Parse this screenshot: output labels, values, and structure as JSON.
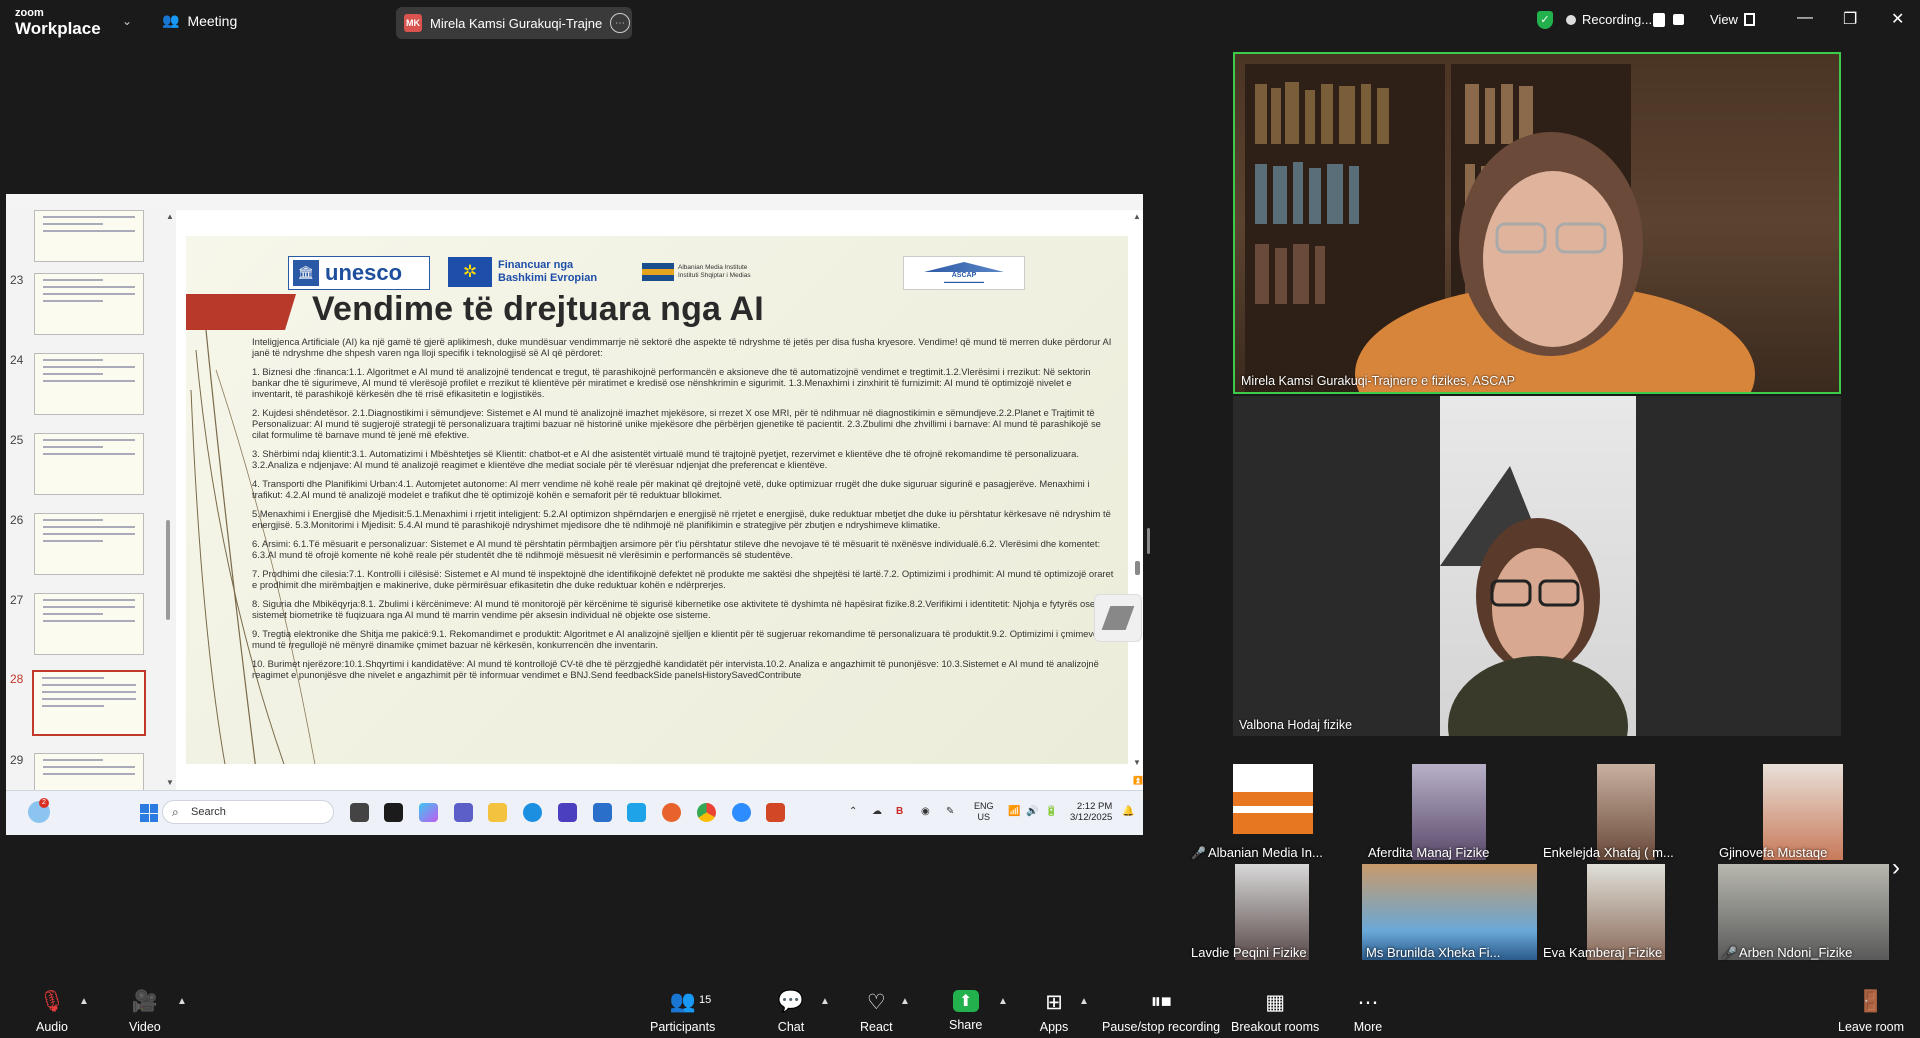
{
  "app": {
    "logo_top": "zoom",
    "logo_bottom": "Workplace",
    "meeting_label": "Meeting",
    "speaker_initials": "MK",
    "speaker_pill": "Mirela Kamsi Gurakuqi-Trajnere e",
    "recording_label": "Recording...",
    "view_label": "View"
  },
  "slides_panel": {
    "items": [
      {
        "num": "23"
      },
      {
        "num": "24"
      },
      {
        "num": "25"
      },
      {
        "num": "26"
      },
      {
        "num": "27"
      },
      {
        "num": "28",
        "active": true
      },
      {
        "num": "29"
      }
    ]
  },
  "slide": {
    "logo_unesco": "unesco",
    "logo_eu_line1": "Financuar nga",
    "logo_eu_line2": "Bashkimi Evropian",
    "logo_ami_line1": "Albanian Media Institute",
    "logo_ami_line2": "Instituti Shqiptar i Medias",
    "logo_ascap": "ASCAP",
    "title": "Vendime të drejtuara nga AI",
    "intro": "Inteligjenca Artificiale (AI) ka një gamë të gjerë aplikimesh, duke mundësuar vendimmarrje në sektorë dhe aspekte të ndryshme të jetës per disa fusha kryesore. Vendime! që mund të merren duke përdorur AI janë të ndryshme dhe shpesh varen nga lloji specifik i teknologjisë së AI që përdoret:",
    "p1": "1. Biznesi dhe :financa:1.1. Algoritmet e AI mund të analizojnë tendencat e tregut, të parashikojnë performancën e aksioneve dhe të automatizojnë vendimet e tregtimit.1.2.Vlerësimi i rrezikut: Në sektorin bankar dhe të sigurimeve, AI mund të vlerësojë profilet e rrezikut të klientëve për miratimet e kredisë ose nënshkrimin e sigurimit. 1.3.Menaxhimi i zinxhirit të furnizimit: AI mund të optimizojë nivelet e inventarit, të parashikojë kërkesën dhe të rrisë efikasitetin e logjistikës.",
    "p2": "2. Kujdesi shëndetësor. 2.1.Diagnostikimi i sëmundjeve: Sistemet e AI mund të analizojnë imazhet mjekësore, si rrezet X ose MRI, për të ndihmuar në diagnostikimin e sëmundjeve.2.2.Planet e Trajtimit të Personalizuar: AI mund të sugjerojë strategji të personalizuara trajtimi bazuar në historinë unike mjekësore dhe përbërjen gjenetike të pacientit. 2.3.Zbulimi dhe zhvillimi i barnave: AI mund të parashikojë se cilat formulime të barnave mund të jenë më efektive.",
    "p3": "3. Shërbimi ndaj klientit:3.1. Automatizimi i Mbështetjes së Klientit: chatbot-et e AI dhe asistentët virtualë mund të trajtojnë pyetjet, rezervimet e klientëve dhe të ofrojnë rekomandime të personalizuara. 3.2.Analiza e ndjenjave: AI mund të analizojë reagimet e klientëve dhe mediat sociale për të vlerësuar ndjenjat dhe preferencat e klientëve.",
    "p4": "4. Transporti dhe Planifikimi Urban:4.1. Automjetet autonome: AI merr vendime në kohë reale për makinat që drejtojnë vetë, duke optimizuar rrugët dhe duke siguruar sigurinë e pasagjerëve. Menaxhimi i trafikut: 4.2.AI mund të analizojë modelet e trafikut dhe të optimizojë kohën e semaforit për të reduktuar bllokimet.",
    "p5": "5.Menaxhimi i Energjisë dhe Mjedisit:5.1.Menaxhimi i rrjetit inteligjent: 5.2.AI optimizon shpërndarjen e energjisë në rrjetet e energjisë, duke reduktuar mbetjet dhe duke iu përshtatur kërkesave në ndryshim të energjisë. 5.3.Monitorimi i Mjedisit: 5.4.AI mund të parashikojë ndryshimet mjedisore dhe të ndihmojë në planifikimin e strategjive për zbutjen e ndryshimeve klimatike.",
    "p6": "6. Arsimi: 6.1.Të mësuarit e personalizuar: Sistemet e AI mund të përshtatin përmbajtjen arsimore për t'iu përshtatur stileve dhe nevojave të të mësuarit të nxënësve individualë.6.2. Vlerësimi dhe komentet: 6.3.AI mund të ofrojë komente në kohë reale për studentët dhe të ndihmojë mësuesit në vlerësimin e performancës së studentëve.",
    "p7": "7. Prodhimi dhe cilesia:7.1. Kontrolli i cilësisë: Sistemet e AI mund të inspektojnë dhe identifikojnë defektet në produkte me saktësi dhe shpejtësi të lartë.7.2. Optimizimi i prodhimit: AI mund të optimizojë oraret e prodhimit dhe mirëmbajtjen e makinerive, duke përmirësuar efikasitetin dhe duke reduktuar kohën e ndërprerjes.",
    "p8": "8. Siguria dhe Mbikëqyrja:8.1. Zbulimi i kërcënimeve: AI mund të monitorojë për kërcënime të sigurisë kibernetike ose aktivitete të dyshimta në hapësirat fizike.8.2.Verifikimi i identitetit: Njohja e fytyrës ose sistemet biometrike të fuqizuara nga AI mund të marrin vendime për aksesin individual në objekte ose sisteme.",
    "p9": "9. Tregtia elektronike dhe Shitja me pakicë:9.1. Rekomandimet e produktit: Algoritmet e AI analizojnë sjelljen e klientit për të sugjeruar rekomandime të personalizuara të produktit.9.2. Optimizimi i çmimeve: AI mund të rregullojë në mënyrë dinamike çmimet bazuar në kërkesën, konkurrencën dhe inventarin.",
    "p10": "10. Burimet njerëzore:10.1.Shqyrtimi i kandidatëve: AI mund të kontrollojë CV-të dhe të përzgjedhë kandidatët për intervista.10.2. Analiza e angazhimit të punonjësve: 10.3.Sistemet e AI mund të analizojnë reagimet e punonjësve dhe nivelet e angazhimit për të informuar vendimet e BNJ.Send feedbackSide panelsHistorySavedContribute"
  },
  "taskbar": {
    "search_placeholder": "Search",
    "badge": "2",
    "lang_line1": "ENG",
    "lang_line2": "US",
    "time": "2:12 PM",
    "date": "3/12/2025"
  },
  "videos": {
    "main1_name": "Mirela Kamsi Gurakuqi-Trajnere e fizikes, ASCAP",
    "main2_name": "Valbona Hodaj fizike"
  },
  "participants_strip": [
    {
      "name": "Albanian Media In...",
      "muted": true
    },
    {
      "name": "Aferdita Manaj Fizike",
      "muted": false
    },
    {
      "name": "Enkelejda Xhafaj ( m...",
      "muted": false
    },
    {
      "name": "Gjinovefa Mustaqe",
      "muted": false
    },
    {
      "name": "Lavdie Peqini Fizike",
      "muted": false
    },
    {
      "name": "Ms Brunilda Xheka Fi...",
      "muted": false
    },
    {
      "name": "Eva Kamberaj Fizike",
      "muted": false
    },
    {
      "name": "Arben Ndoni_Fizike",
      "muted": true
    }
  ],
  "toolbar": {
    "audio": "Audio",
    "video": "Video",
    "participants": "Participants",
    "participants_count": "15",
    "chat": "Chat",
    "react": "React",
    "share": "Share",
    "apps": "Apps",
    "pause_stop": "Pause/stop recording",
    "breakout": "Breakout rooms",
    "more": "More",
    "leave": "Leave room"
  },
  "colors": {
    "accent_green": "#3dcc4a",
    "share_green": "#22b14c",
    "slide_red": "#b8382a",
    "muted_red": "#e23b3b"
  }
}
